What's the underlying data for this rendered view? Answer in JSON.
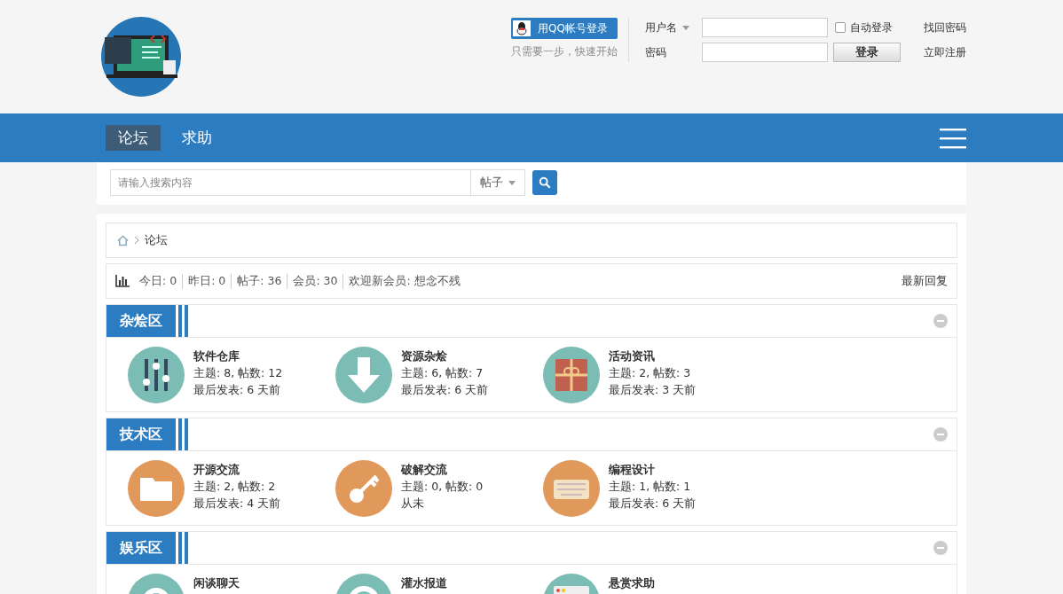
{
  "login": {
    "qq_button": "用QQ帐号登录",
    "qq_hint": "只需要一步，快速开始",
    "username_label": "用户名",
    "password_label": "密码",
    "auto_login": {
      "label": "自动登录",
      "checked": false
    },
    "forgot": "找回密码",
    "login_button": "登录",
    "register": "立即注册"
  },
  "nav": {
    "items": [
      {
        "label": "论坛",
        "selected": true
      },
      {
        "label": "求助",
        "selected": false
      }
    ]
  },
  "search": {
    "placeholder": "请输入搜索内容",
    "scope": "帖子"
  },
  "breadcrumb": [
    "论坛"
  ],
  "stats": {
    "items": [
      "今日: 0",
      "昨日: 0",
      "帖子: 36",
      "会员: 30",
      "欢迎新会员: 想念不残"
    ],
    "latest": "最新回复"
  },
  "sections": [
    {
      "title": "杂烩区",
      "forums": [
        {
          "name": "软件仓库",
          "color": "#7bbcb5",
          "threads": "主题: 8, 帖数: 12",
          "last": "最后发表: 6 天前"
        },
        {
          "name": "资源杂烩",
          "color": "#7bbcb5",
          "threads": "主题: 6, 帖数: 7",
          "last": "最后发表: 6 天前"
        },
        {
          "name": "活动资讯",
          "color": "#7bbcb5",
          "threads": "主题: 2, 帖数: 3",
          "last": "最后发表: 3 天前"
        }
      ]
    },
    {
      "title": "技术区",
      "forums": [
        {
          "name": "开源交流",
          "color": "#e0995a",
          "threads": "主题: 2, 帖数: 2",
          "last": "最后发表: 4 天前"
        },
        {
          "name": "破解交流",
          "color": "#e0995a",
          "threads": "主题: 0, 帖数: 0",
          "last": "从未"
        },
        {
          "name": "编程设计",
          "color": "#e0995a",
          "threads": "主题: 1, 帖数: 1",
          "last": "最后发表: 6 天前"
        }
      ]
    },
    {
      "title": "娱乐区",
      "forums": [
        {
          "name": "闲谈聊天",
          "color": "#7bbcb5"
        },
        {
          "name": "灌水报道",
          "color": "#7bbcb5"
        },
        {
          "name": "悬赏求助",
          "color": "#7bbcb5"
        }
      ]
    }
  ]
}
